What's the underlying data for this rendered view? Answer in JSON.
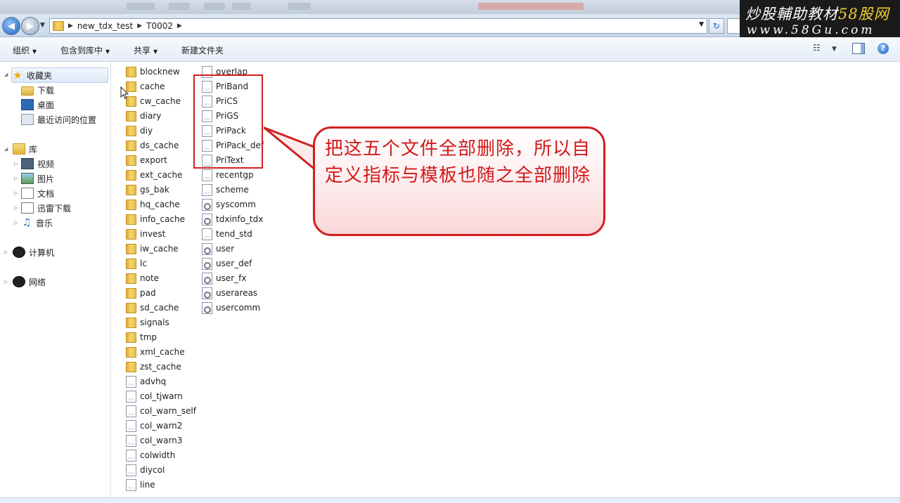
{
  "address": {
    "crumbs": [
      "new_tdx_test",
      "T0002"
    ]
  },
  "watermark": {
    "line1_prefix": "炒股輔助教材",
    "line1_highlight": "58股网",
    "line2": "www.58Gu.com"
  },
  "toolbar": {
    "organize": "组织",
    "include_in_library": "包含到库中",
    "share": "共享",
    "new_folder": "新建文件夹"
  },
  "nav": {
    "favorites": "收藏夹",
    "downloads": "下载",
    "desktop": "桌面",
    "recent": "最近访问的位置",
    "libraries": "库",
    "videos": "视频",
    "pictures": "图片",
    "documents": "文档",
    "thunder": "迅雷下载",
    "music": "音乐",
    "computer": "计算机",
    "network": "网络"
  },
  "files": {
    "col1": [
      {
        "name": "blocknew",
        "type": "folder"
      },
      {
        "name": "cache",
        "type": "folder"
      },
      {
        "name": "cw_cache",
        "type": "folder"
      },
      {
        "name": "diary",
        "type": "folder"
      },
      {
        "name": "diy",
        "type": "folder"
      },
      {
        "name": "ds_cache",
        "type": "folder"
      },
      {
        "name": "export",
        "type": "folder"
      },
      {
        "name": "ext_cache",
        "type": "folder"
      },
      {
        "name": "gs_bak",
        "type": "folder"
      },
      {
        "name": "hq_cache",
        "type": "folder"
      },
      {
        "name": "info_cache",
        "type": "folder"
      },
      {
        "name": "invest",
        "type": "folder"
      },
      {
        "name": "iw_cache",
        "type": "folder"
      },
      {
        "name": "lc",
        "type": "folder"
      },
      {
        "name": "note",
        "type": "folder"
      },
      {
        "name": "pad",
        "type": "folder"
      },
      {
        "name": "sd_cache",
        "type": "folder"
      },
      {
        "name": "signals",
        "type": "folder"
      },
      {
        "name": "tmp",
        "type": "folder"
      },
      {
        "name": "xml_cache",
        "type": "folder"
      },
      {
        "name": "zst_cache",
        "type": "folder"
      },
      {
        "name": "advhq",
        "type": "doc"
      },
      {
        "name": "col_tjwarn",
        "type": "doc"
      },
      {
        "name": "col_warn_self",
        "type": "doc"
      },
      {
        "name": "col_warn2",
        "type": "doc"
      },
      {
        "name": "col_warn3",
        "type": "doc"
      },
      {
        "name": "colwidth",
        "type": "doc"
      },
      {
        "name": "diycol",
        "type": "doc"
      },
      {
        "name": "line",
        "type": "doc"
      }
    ],
    "col2": [
      {
        "name": "overlap",
        "type": "doc"
      },
      {
        "name": "PriBand",
        "type": "doc"
      },
      {
        "name": "PriCS",
        "type": "doc"
      },
      {
        "name": "PriGS",
        "type": "doc"
      },
      {
        "name": "PriPack",
        "type": "doc"
      },
      {
        "name": "PriPack_def",
        "type": "doc"
      },
      {
        "name": "PriText",
        "type": "doc"
      },
      {
        "name": "recentgp",
        "type": "doc"
      },
      {
        "name": "scheme",
        "type": "doc"
      },
      {
        "name": "syscomm",
        "type": "cfg"
      },
      {
        "name": "tdxinfo_tdx",
        "type": "cfg"
      },
      {
        "name": "tend_std",
        "type": "doc"
      },
      {
        "name": "user",
        "type": "cfg"
      },
      {
        "name": "user_def",
        "type": "cfg"
      },
      {
        "name": "user_fx",
        "type": "cfg"
      },
      {
        "name": "userareas",
        "type": "cfg"
      },
      {
        "name": "usercomm",
        "type": "cfg"
      }
    ]
  },
  "callout": {
    "text": "把这五个文件全部删除，所以自定义指标与模板也随之全部删除"
  },
  "colors": {
    "annotation_red": "#d21f1f",
    "callout_text": "#d11a1a"
  }
}
